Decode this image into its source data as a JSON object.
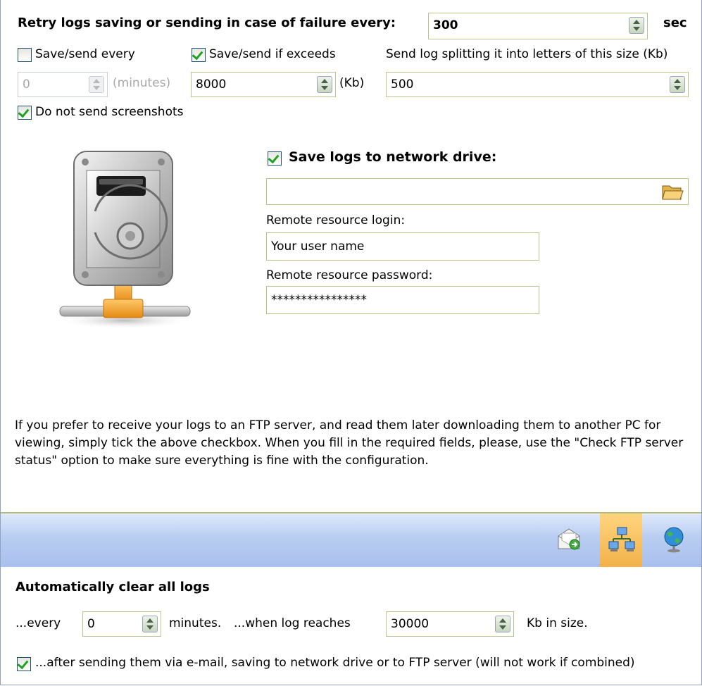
{
  "retry": {
    "label": "Retry logs saving or sending in case of failure every:",
    "value": "300",
    "unit": "sec"
  },
  "save_send_every": {
    "label": "Save/send every",
    "checked": false,
    "value": "0",
    "unit": "(minutes)"
  },
  "save_send_exceeds": {
    "label": "Save/send if exceeds",
    "checked": true,
    "value": "8000",
    "unit": "(Kb)"
  },
  "split": {
    "label": "Send log splitting it into letters of this size (Kb)",
    "value": "500"
  },
  "no_screenshots": {
    "label": "Do not send screenshots",
    "checked": true
  },
  "network": {
    "checkbox_label": "Save logs to network drive:",
    "checked": true,
    "path_value": "",
    "login_label": "Remote resource login:",
    "login_value": "Your user name",
    "password_label": "Remote resource password:",
    "password_value": "****************"
  },
  "info_text": "If you prefer to receive your logs to an FTP server, and read them later downloading them to another PC for viewing, simply tick the above checkbox. When you fill in the required fields, please, use the \"Check FTP server status\" option to make sure everything is fine with the configuration.",
  "toolbar": {
    "buttons": [
      {
        "icon": "email-send-icon",
        "active": false
      },
      {
        "icon": "network-icon",
        "active": true
      },
      {
        "icon": "globe-icon",
        "active": false
      }
    ]
  },
  "clear": {
    "title": "Automatically clear all logs",
    "every_label": "...every",
    "every_value": "0",
    "minutes_label": "minutes.",
    "reaches_label": "...when log reaches",
    "reaches_value": "30000",
    "kb_label": "Kb in size.",
    "after_label": "...after sending them via e-mail, saving to network drive or to FTP server (will not work if combined)",
    "after_checked": true
  },
  "colors": {
    "toolbar_gradient": "#b9cdf2",
    "active_button": "#f3b24a",
    "field_border": "#b9c48f",
    "check_green": "#21a121"
  }
}
